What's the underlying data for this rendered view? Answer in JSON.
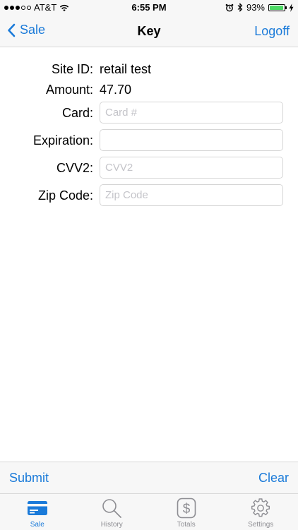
{
  "status_bar": {
    "carrier": "AT&T",
    "time": "6:55 PM",
    "battery": "93%",
    "battery_level": 0.93,
    "signal_filled": 3,
    "signal_total": 5
  },
  "nav": {
    "back_label": "Sale",
    "title": "Key",
    "logoff_label": "Logoff"
  },
  "form": {
    "site_id_label": "Site ID:",
    "site_id_value": "retail test",
    "amount_label": "Amount:",
    "amount_value": "47.70",
    "card_label": "Card:",
    "card_placeholder": "Card #",
    "card_value": "",
    "expiration_label": "Expiration:",
    "expiration_placeholder": "",
    "expiration_value": "",
    "cvv2_label": "CVV2:",
    "cvv2_placeholder": "CVV2",
    "cvv2_value": "",
    "zip_label": "Zip Code:",
    "zip_placeholder": "Zip Code",
    "zip_value": ""
  },
  "actions": {
    "submit_label": "Submit",
    "clear_label": "Clear"
  },
  "tabs": [
    {
      "label": "Sale",
      "icon": "credit-card-icon",
      "active": true
    },
    {
      "label": "History",
      "icon": "search-icon",
      "active": false
    },
    {
      "label": "Totals",
      "icon": "dollar-icon",
      "active": false
    },
    {
      "label": "Settings",
      "icon": "gear-icon",
      "active": false
    }
  ],
  "colors": {
    "accent": "#1a7ad9",
    "inactive": "#8e8e93",
    "bar_background": "#f7f7f7",
    "battery": "#4cd964"
  }
}
